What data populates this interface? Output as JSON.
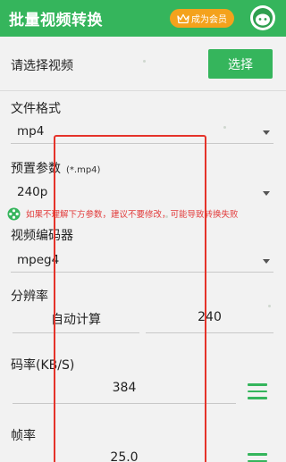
{
  "appbar": {
    "title": "批量视频转换",
    "member_label": "成为会员",
    "member_icon": "crown-icon",
    "avatar_icon": "avatar-icon",
    "bg_color": "#35b55c",
    "member_color": "#f4a21c"
  },
  "select_video": {
    "label": "请选择视频",
    "button": "选择"
  },
  "file_format": {
    "label": "文件格式",
    "value": "mp4"
  },
  "preset": {
    "label": "预置参数",
    "sub": "(*.mp4)",
    "value": "240p"
  },
  "warning": {
    "text": "如果不理解下方参数，建议不要修改，可能导致转换失败",
    "color": "#e23b3b"
  },
  "video_encoder": {
    "label": "视频编码器",
    "value": "mpeg4"
  },
  "resolution": {
    "label": "分辨率",
    "width_value": "自动计算",
    "height_value": "240"
  },
  "bitrate": {
    "label": "码率(KB/S)",
    "value": "384"
  },
  "framerate": {
    "label": "帧率",
    "value": "25.0"
  }
}
